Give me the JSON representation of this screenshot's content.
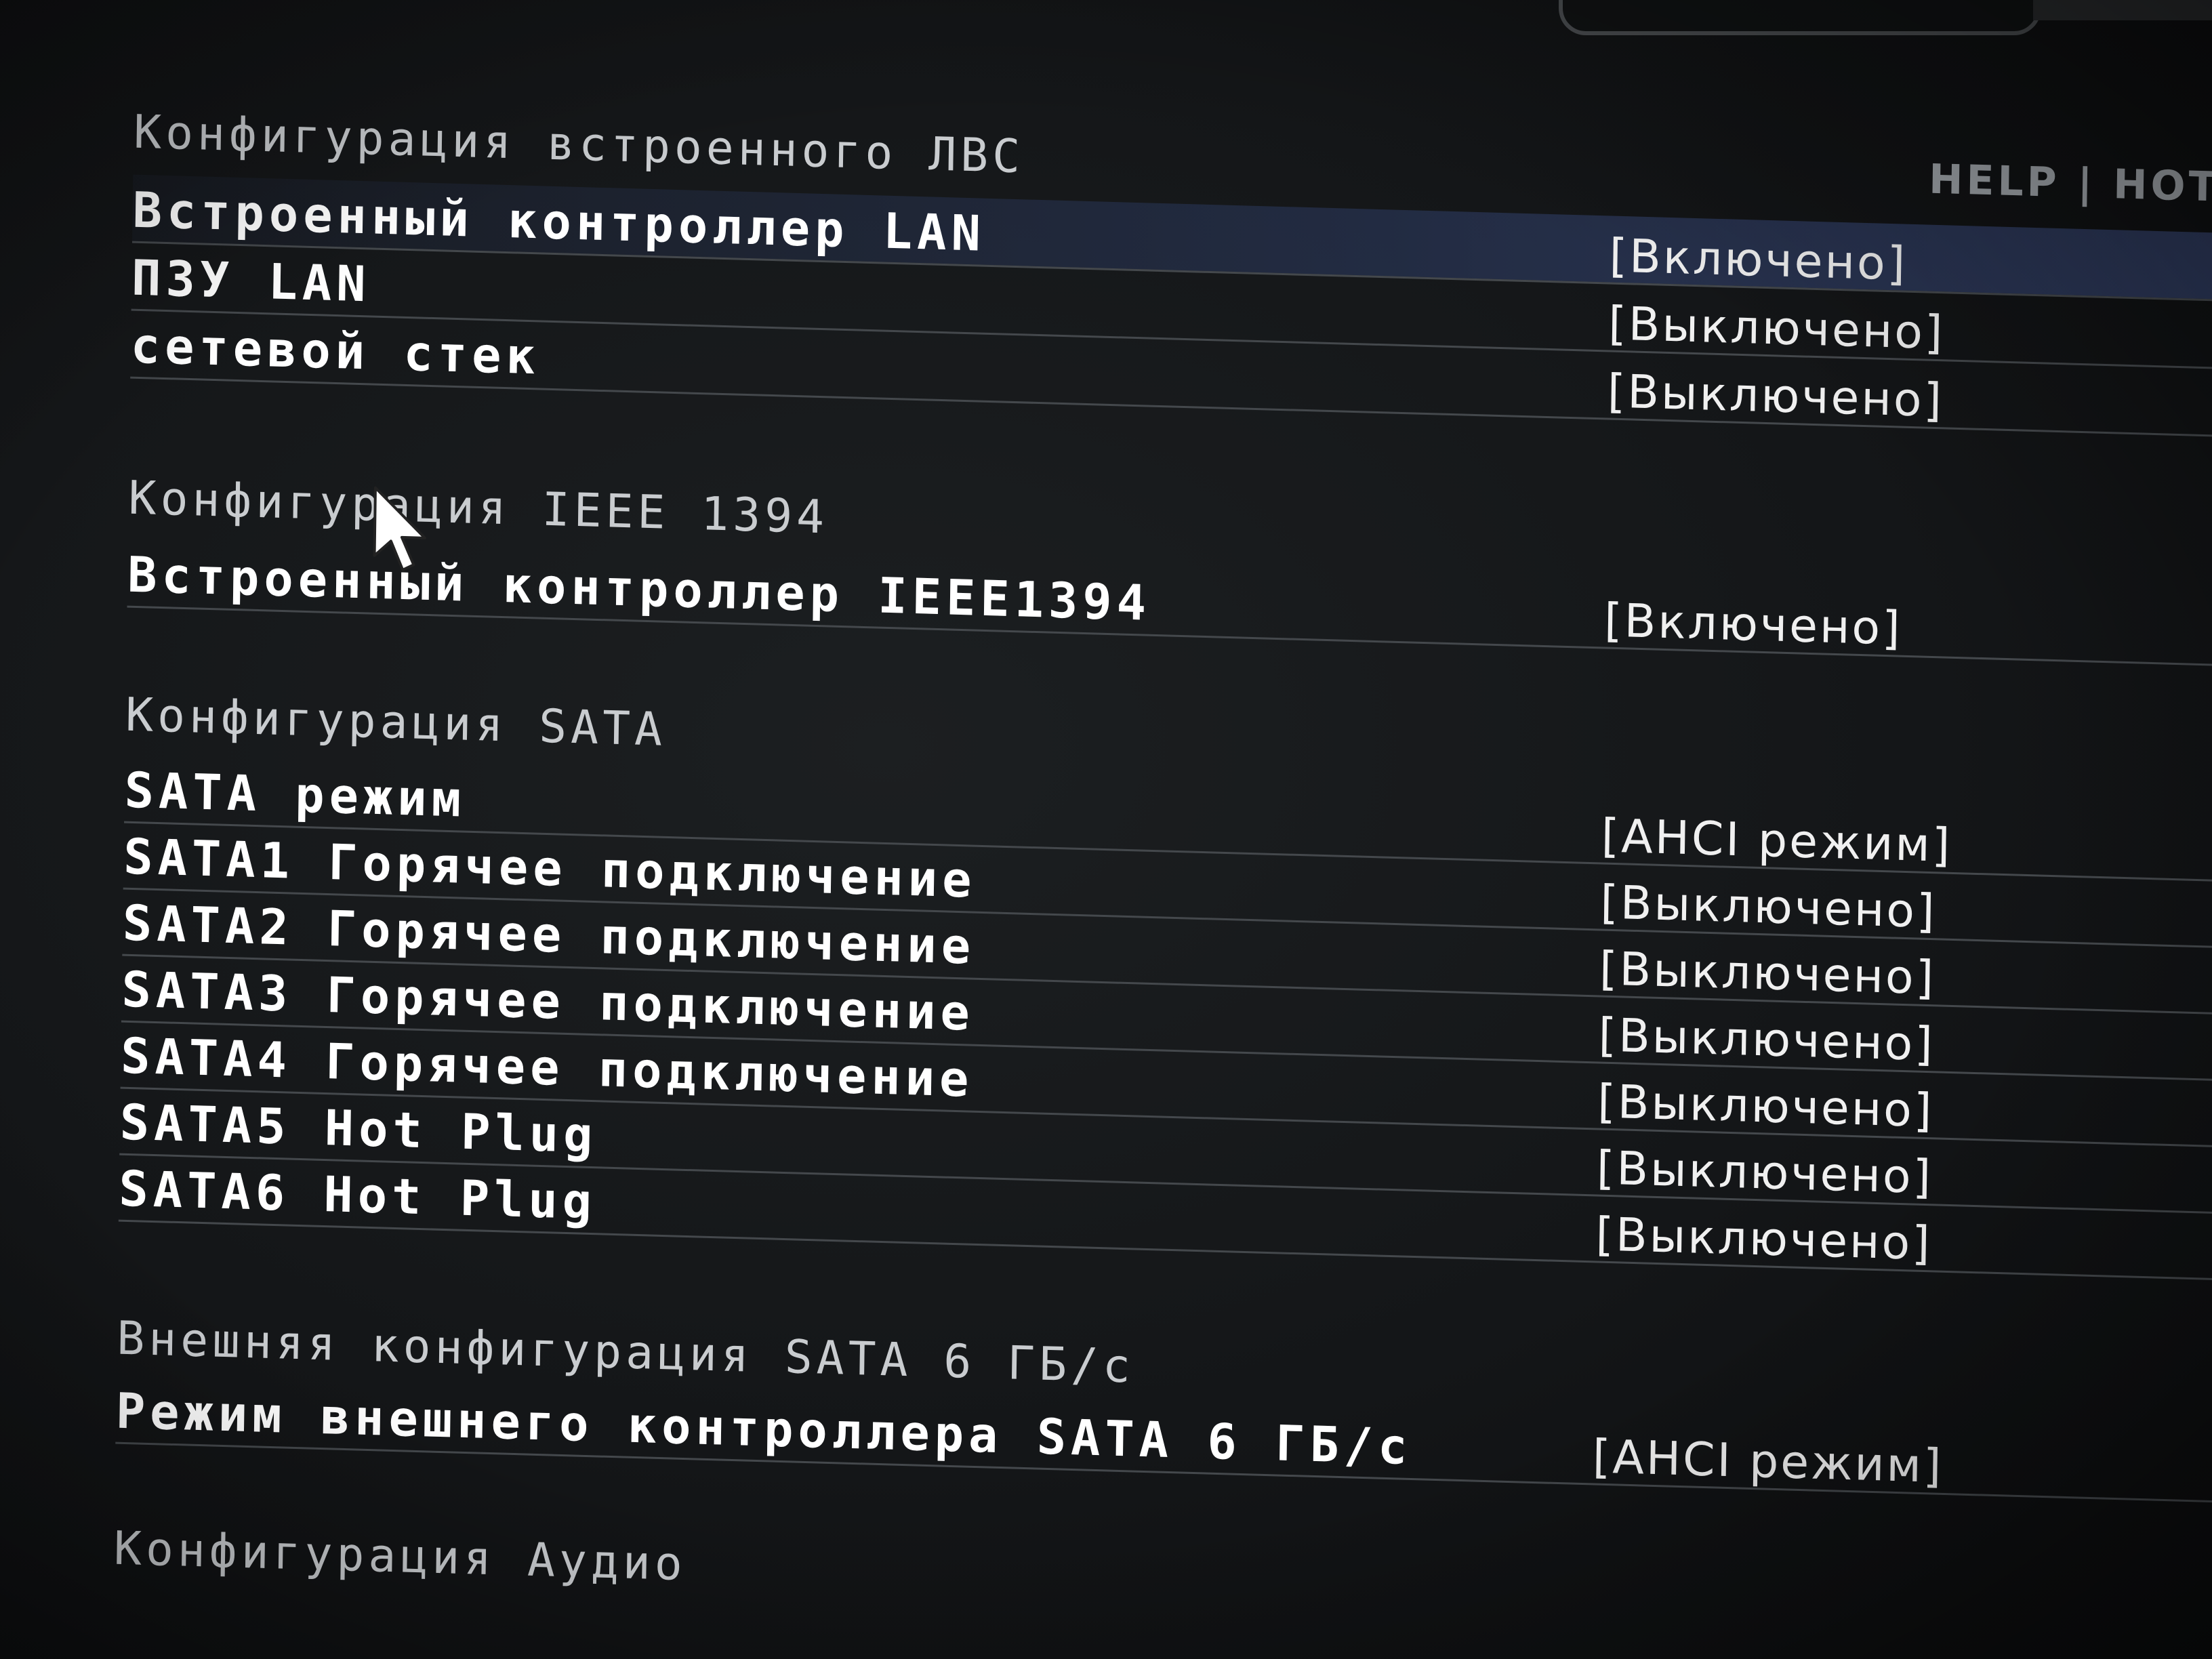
{
  "header": {
    "help_text": "HELP | HOT"
  },
  "sections": {
    "lan": {
      "title": "Конфигурация встроенного ЛВС",
      "rows": [
        {
          "label": "Встроенный контроллер LAN",
          "value": "[Включено]"
        },
        {
          "label": "ПЗУ LAN",
          "value": "[Выключено]"
        },
        {
          "label": "сетевой стек",
          "value": "[Выключено]"
        }
      ]
    },
    "ieee": {
      "title": "Конфигурация IEEE 1394",
      "rows": [
        {
          "label": "Встроенный контроллер IEEE1394",
          "value": "[Включено]"
        }
      ]
    },
    "sata": {
      "title": "Конфигурация SATA",
      "rows": [
        {
          "label": "SATA режим",
          "value": "[AHCI режим]"
        },
        {
          "label": "SATA1 Горячее подключение",
          "value": "[Выключено]"
        },
        {
          "label": "SATA2 Горячее подключение",
          "value": "[Выключено]"
        },
        {
          "label": "SATA3 Горячее подключение",
          "value": "[Выключено]"
        },
        {
          "label": "SATA4 Горячее подключение",
          "value": "[Выключено]"
        },
        {
          "label": "SATA5 Hot Plug",
          "value": "[Выключено]"
        },
        {
          "label": "SATA6 Hot Plug",
          "value": "[Выключено]"
        }
      ]
    },
    "ext_sata": {
      "title": "Внешняя конфигурация SATA 6 ГБ/с",
      "rows": [
        {
          "label": "Режим внешнего контроллера SATA 6 ГБ/с",
          "value": "[AHCI режим]"
        }
      ]
    },
    "audio": {
      "title": "Конфигурация Аудио"
    }
  },
  "colors": {
    "background": "#141618",
    "text": "#ffffff",
    "section_text": "#c9cccf",
    "highlight": "#37467a",
    "divider": "#44484c"
  },
  "icons": {
    "cursor": "mouse-pointer-icon"
  }
}
